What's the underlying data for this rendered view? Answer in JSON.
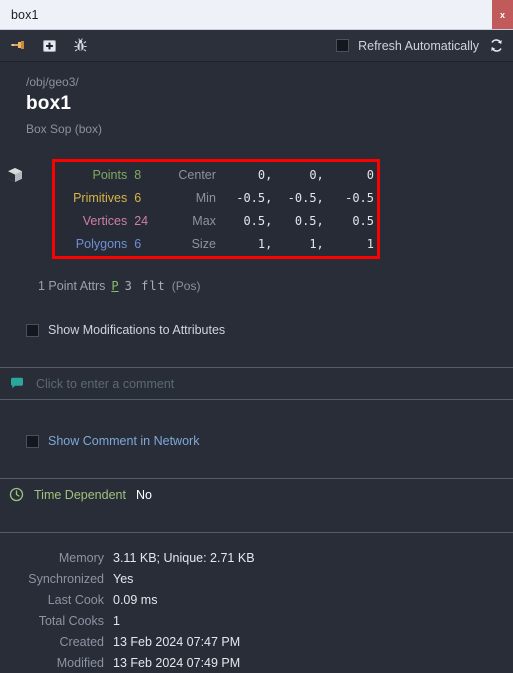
{
  "window": {
    "title": "box1",
    "close_label": "x"
  },
  "toolbar": {
    "icons": [
      {
        "name": "pin-icon",
        "glyph": "pin"
      },
      {
        "name": "add-icon",
        "glyph": "plus-square"
      },
      {
        "name": "bug-icon",
        "glyph": "bug"
      }
    ],
    "refresh_checkbox_label": "Refresh Automatically",
    "refresh_checkbox_checked": false,
    "refresh_icon": "refresh-icon"
  },
  "header": {
    "path": "/obj/geo3/",
    "name": "box1",
    "type": "Box Sop (box)"
  },
  "geometry": {
    "icon": "cube-icon",
    "highlight_color": "#ff0000",
    "counts": [
      {
        "label": "Points",
        "value": "8",
        "color": "#7faa63"
      },
      {
        "label": "Primitives",
        "value": "6",
        "color": "#d8b44a"
      },
      {
        "label": "Vertices",
        "value": "24",
        "color": "#cd7fa8"
      },
      {
        "label": "Polygons",
        "value": "6",
        "color": "#6f8fd4"
      }
    ],
    "bounds": [
      {
        "label": "Center",
        "x": "0,",
        "y": "0,",
        "z": "0"
      },
      {
        "label": "Min",
        "x": "-0.5,",
        "y": "-0.5,",
        "z": "-0.5"
      },
      {
        "label": "Max",
        "x": "0.5,",
        "y": "0.5,",
        "z": "0.5"
      },
      {
        "label": "Size",
        "x": "1,",
        "y": "1,",
        "z": "1"
      }
    ]
  },
  "attrs": {
    "count_label": "1 Point Attrs",
    "name": "P",
    "type": "3 flt",
    "desc": "(Pos)"
  },
  "options": {
    "show_modifications_label": "Show Modifications to Attributes",
    "show_modifications_checked": false,
    "show_comment_label": "Show Comment in Network",
    "show_comment_checked": false
  },
  "comment": {
    "placeholder": "Click to enter a comment"
  },
  "time_dependent": {
    "label": "Time Dependent",
    "value": "No"
  },
  "details": [
    {
      "label": "Memory",
      "value": "3.11 KB; Unique: 2.71 KB"
    },
    {
      "label": "Synchronized",
      "value": "Yes"
    },
    {
      "label": "Last Cook",
      "value": "0.09 ms"
    },
    {
      "label": "Total Cooks",
      "value": "1"
    },
    {
      "label": "Created",
      "value": "13 Feb 2024 07:47 PM"
    },
    {
      "label": "Modified",
      "value": "13 Feb 2024 07:49 PM"
    }
  ]
}
